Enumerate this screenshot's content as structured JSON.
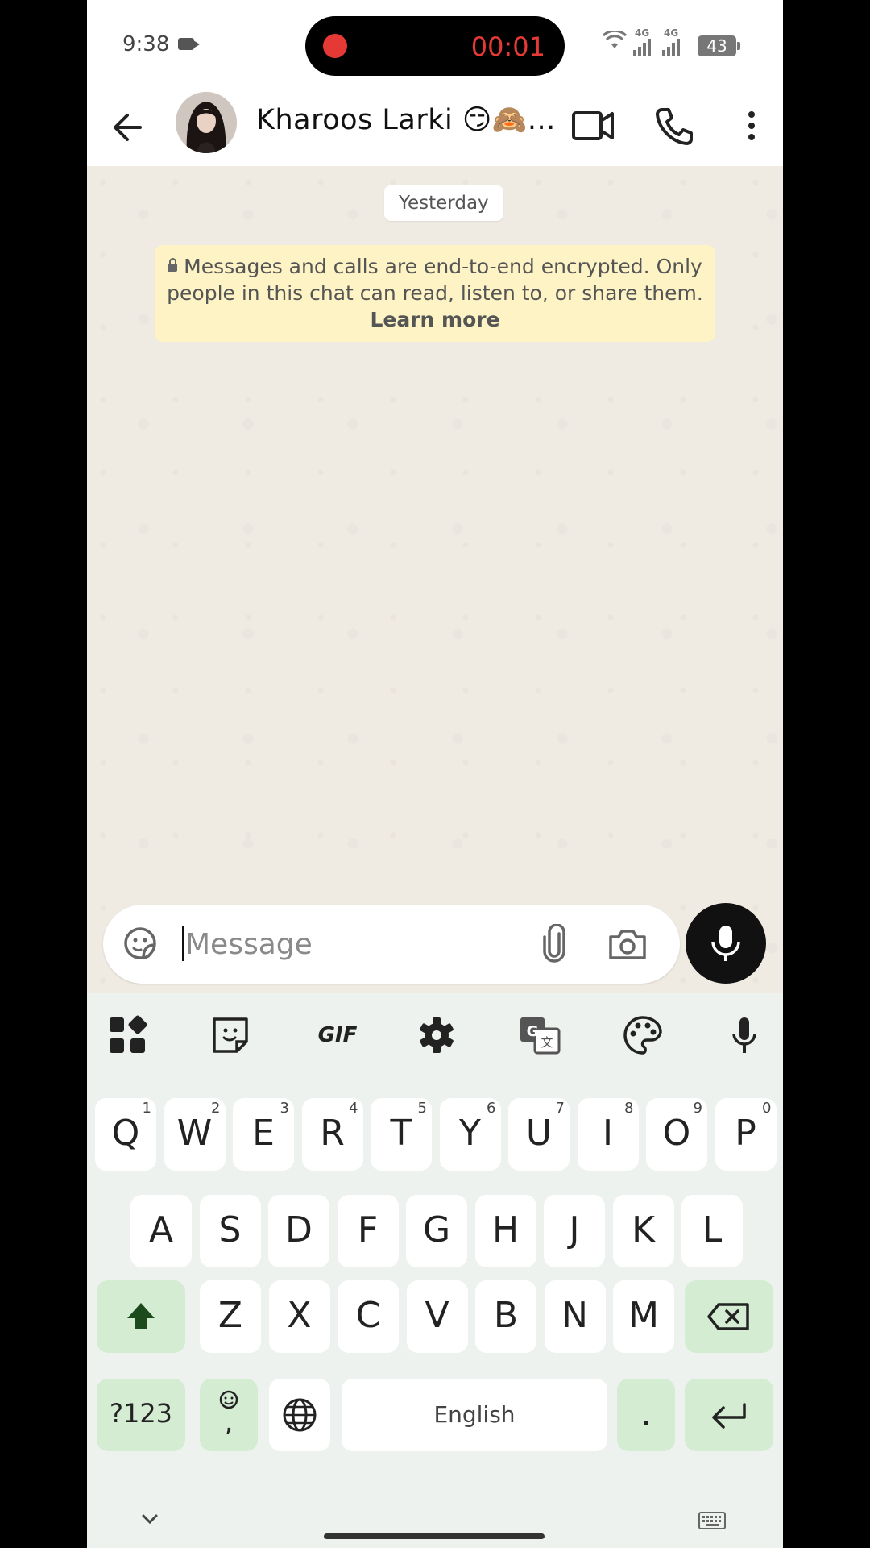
{
  "status_bar": {
    "time": "9:38",
    "recording_time": "00:01",
    "network_1": "4G",
    "network_2": "4G",
    "battery": "43"
  },
  "header": {
    "contact_name": "Kharoos Larki 😏🙈...",
    "icons": [
      "back-arrow-icon",
      "avatar",
      "video-call-icon",
      "phone-icon",
      "more-vertical-icon"
    ]
  },
  "chat": {
    "date_label": "Yesterday",
    "encryption_text": "Messages and calls are end-to-end encrypted. Only people in this chat can read, listen to, or share them.",
    "learn_more": "Learn more"
  },
  "input": {
    "placeholder": "Message"
  },
  "keyboard": {
    "toolbar": [
      "apps-grid-icon",
      "sticker-icon",
      "GIF",
      "settings-gear-icon",
      "translate-icon",
      "palette-icon",
      "mic-icon"
    ],
    "gif_label": "GIF",
    "row1": [
      {
        "k": "Q",
        "h": "1"
      },
      {
        "k": "W",
        "h": "2"
      },
      {
        "k": "E",
        "h": "3"
      },
      {
        "k": "R",
        "h": "4"
      },
      {
        "k": "T",
        "h": "5"
      },
      {
        "k": "Y",
        "h": "6"
      },
      {
        "k": "U",
        "h": "7"
      },
      {
        "k": "I",
        "h": "8"
      },
      {
        "k": "O",
        "h": "9"
      },
      {
        "k": "P",
        "h": "0"
      }
    ],
    "row2": [
      "A",
      "S",
      "D",
      "F",
      "G",
      "H",
      "J",
      "K",
      "L"
    ],
    "row3": [
      "Z",
      "X",
      "C",
      "V",
      "B",
      "N",
      "M"
    ],
    "symbols_label": "?123",
    "comma_label": ",",
    "space_label": "English",
    "period_label": ".",
    "accent_color": "#d4ecd2"
  }
}
